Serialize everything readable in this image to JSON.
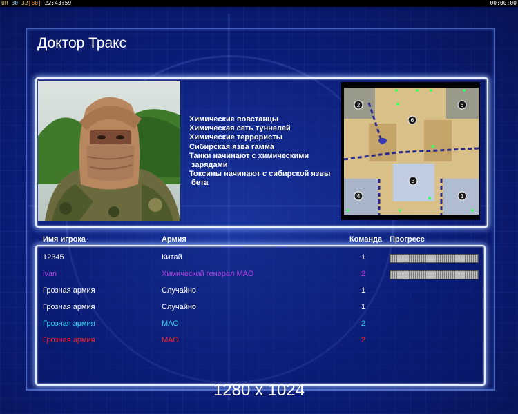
{
  "topbar": {
    "ur": "UR",
    "n30": "30",
    "n32": "32",
    "n60": "[60]",
    "clock": "22:43:59",
    "right_clock": "00:00:00"
  },
  "title": "Доктор Тракс",
  "perks": [
    "Химические повстанцы",
    "Химическая сеть туннелей",
    "Химические террористы",
    "Сибирская язва гамма",
    "Танки начинают с химическими",
    " зарядами",
    "Токсины начинают с сибирской язвы",
    " бета"
  ],
  "minimap": {
    "spawns": [
      "2",
      "5",
      "6",
      "3",
      "4",
      "1"
    ]
  },
  "table": {
    "headers": {
      "name": "Имя игрока",
      "army": "Армия",
      "team": "Команда",
      "progress": "Прогресс"
    },
    "rows": [
      {
        "name": "12345",
        "army": "Китай",
        "team": "1",
        "color": "#ffffff",
        "progress": 1.0
      },
      {
        "name": "ivan",
        "army": "Химический генерал MAO",
        "team": "2",
        "color": "#b040e0",
        "progress": 1.0
      },
      {
        "name": "Грозная армия",
        "army": "Случайно",
        "team": "1",
        "color": "#ffffff"
      },
      {
        "name": "Грозная армия",
        "army": "Случайно",
        "team": "1",
        "color": "#ffffff"
      },
      {
        "name": "Грозная армия",
        "army": "МАО",
        "team": "2",
        "color": "#38d0f0"
      },
      {
        "name": "Грозная армия",
        "army": "МАО",
        "team": "2",
        "color": "#ff2020"
      }
    ]
  },
  "resolution": "1280 x 1024"
}
